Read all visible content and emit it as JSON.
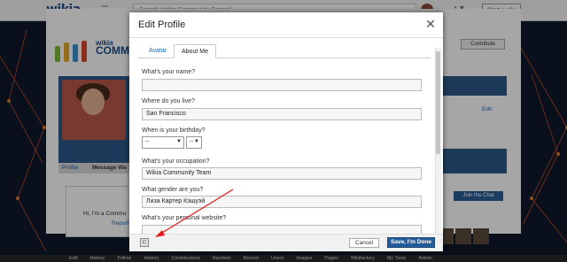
{
  "global_nav": {
    "logo": "wikia",
    "search_placeholder": "Search within Community Central",
    "start_wiki_label": "Start a wiki"
  },
  "wiki": {
    "logo_small": "wikia",
    "logo_big": "COMMUNITY CENTRAL",
    "contribute_label": "Contribute",
    "edit_label": "Edit",
    "profile_tab": "Profile",
    "message_tab": "Message Wa",
    "wall_greeting": "Hi, I'm a Commu",
    "wall_report": "Report",
    "join_chat_label": "Join the Chat"
  },
  "bottom_bar": {
    "items": [
      "Edit",
      "History",
      "Follow",
      "History",
      "Contributions",
      "Random",
      "Recent",
      "Users",
      "Images",
      "Pages",
      "Wikifactory",
      "My Tools",
      "Admin"
    ]
  },
  "modal": {
    "title": "Edit Profile",
    "tabs": [
      "Avatar",
      "About Me"
    ],
    "active_tab": "About Me",
    "fields": {
      "name": {
        "label": "What's your name?",
        "value": ""
      },
      "location": {
        "label": "Where do you live?",
        "value": "San Francisco"
      },
      "birthday": {
        "label": "When is your birthday?",
        "month": "--",
        "day": "--"
      },
      "occupation": {
        "label": "What's your occupation?",
        "value": "Wikia Community Team"
      },
      "gender": {
        "label": "What gender are you?",
        "value": "Лиза Картер Кэшуэй"
      },
      "website": {
        "label": "What's your personal website?",
        "value": ""
      }
    },
    "cancel_label": "Cancel",
    "save_label": "Save, I'm Done"
  },
  "colors": {
    "accent": "#245c99",
    "link": "#1a66b0",
    "annotation_arrow": "#e0191b"
  }
}
